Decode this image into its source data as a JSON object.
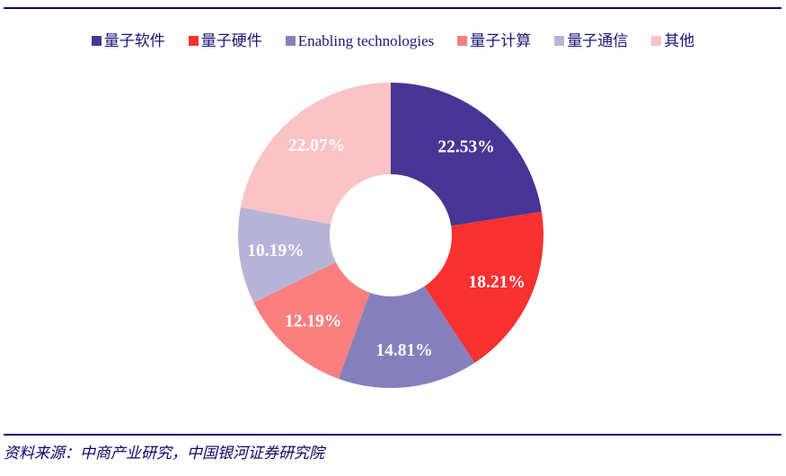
{
  "chart_data": {
    "type": "pie",
    "variant": "donut",
    "title": "",
    "subtitle": "",
    "xlabel": "",
    "ylabel": "",
    "grid": false,
    "legend_position": "top",
    "hole_ratio": 0.4,
    "start_angle_deg": 0,
    "direction": "clockwise",
    "unit": "%",
    "categories": [
      "量子软件",
      "量子硬件",
      "Enabling technologies",
      "量子计算",
      "量子通信",
      "其他"
    ],
    "values": [
      22.53,
      18.21,
      14.81,
      12.19,
      10.19,
      22.07
    ],
    "labels": [
      "22.53%",
      "18.21%",
      "14.81%",
      "12.19%",
      "10.19%",
      "22.07%"
    ],
    "colors": [
      "#483494",
      "#fa3131",
      "#8580bd",
      "#f9807f",
      "#b7b4d8",
      "#fbc3c5"
    ],
    "slices": [
      {
        "name": "量子软件",
        "value": 22.53,
        "label": "22.53%",
        "color": "#483494"
      },
      {
        "name": "量子硬件",
        "value": 18.21,
        "label": "18.21%",
        "color": "#fa3131"
      },
      {
        "name": "Enabling technologies",
        "value": 14.81,
        "label": "14.81%",
        "color": "#8580bd"
      },
      {
        "name": "量子计算",
        "value": 12.19,
        "label": "12.19%",
        "color": "#f9807f"
      },
      {
        "name": "量子通信",
        "value": 10.19,
        "label": "10.19%",
        "color": "#b7b4d8"
      },
      {
        "name": "其他",
        "value": 22.07,
        "label": "22.07%",
        "color": "#fbc3c5"
      }
    ]
  },
  "legend": {
    "items": [
      {
        "label": "量子软件",
        "color": "#483494"
      },
      {
        "label": "量子硬件",
        "color": "#fa3131"
      },
      {
        "label": "Enabling technologies",
        "color": "#8580bd"
      },
      {
        "label": "量子计算",
        "color": "#f9807f"
      },
      {
        "label": "量子通信",
        "color": "#b7b4d8"
      },
      {
        "label": "其他",
        "color": "#fbc3c5"
      }
    ]
  },
  "footer": {
    "source_note": "资料来源：中商产业研究，中国银河证券研究院"
  },
  "style": {
    "rule_color": "#12046b",
    "text_color": "#1b1579",
    "label_color": "#ffffff",
    "background": "#ffffff"
  }
}
